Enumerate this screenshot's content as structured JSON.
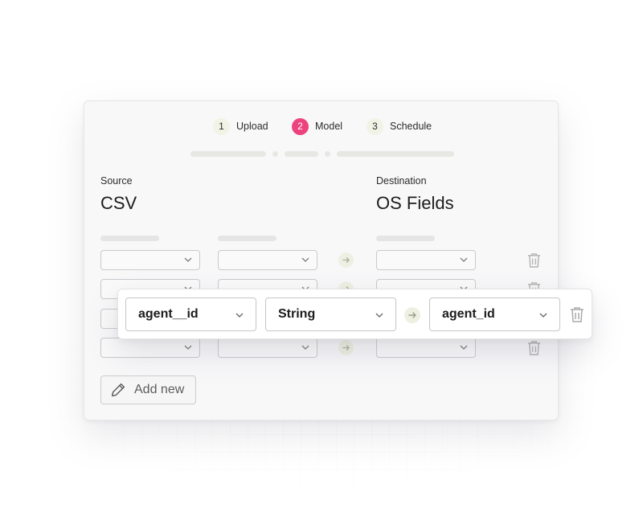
{
  "steps": [
    {
      "number": "1",
      "label": "Upload",
      "active": false
    },
    {
      "number": "2",
      "label": "Model",
      "active": true
    },
    {
      "number": "3",
      "label": "Schedule",
      "active": false
    }
  ],
  "source": {
    "label": "Source",
    "title": "CSV"
  },
  "destination": {
    "label": "Destination",
    "title": "OS Fields"
  },
  "mapping_row": {
    "source_field": "agent__id",
    "type": "String",
    "destination_field": "agent_id"
  },
  "add_button": {
    "label": "Add new"
  },
  "icons": {
    "chevron": "chevron-down-icon",
    "arrow": "arrow-right-icon",
    "trash": "trash-icon",
    "pencil": "pencil-icon"
  },
  "colors": {
    "accent": "#ec3a78",
    "step_bg": "#f1f3e6",
    "arrow_bg": "#eef0e2"
  }
}
